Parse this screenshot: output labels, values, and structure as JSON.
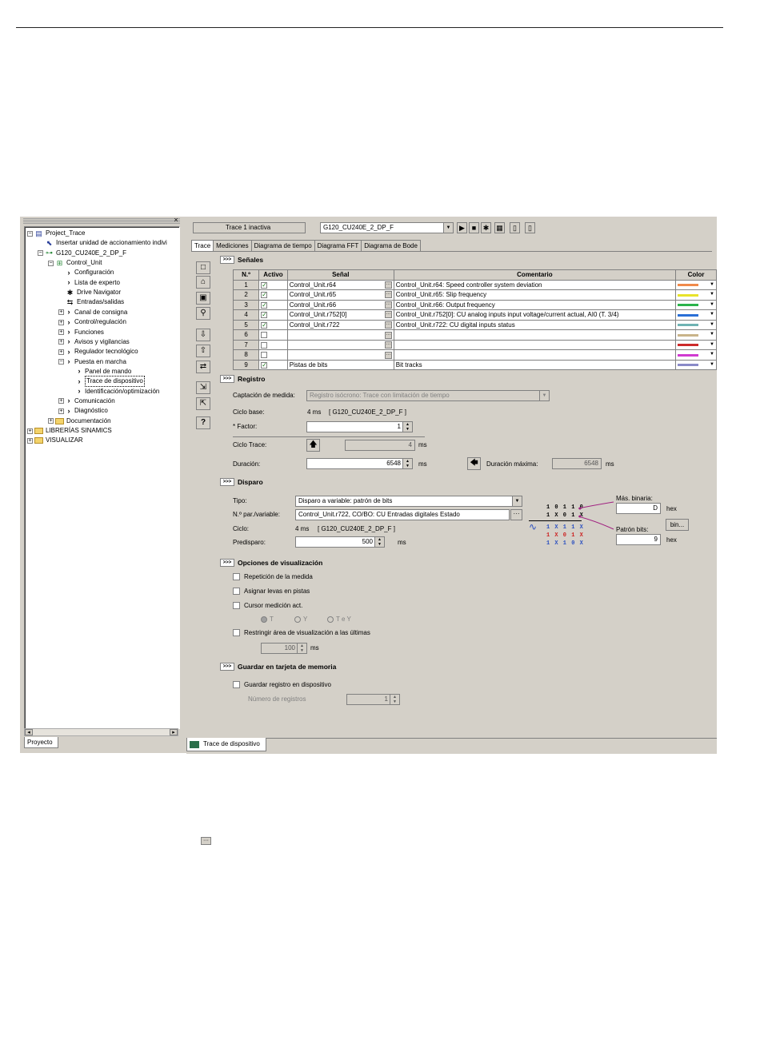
{
  "project": {
    "close_glyph": "×",
    "tab_label": "Proyecto",
    "tree": [
      {
        "label": "Project_Trace",
        "indent": 0,
        "expander": "−",
        "icon": "project"
      },
      {
        "label": "Insertar unidad de accionamiento indivi",
        "indent": 1,
        "expander": "",
        "icon": "insert"
      },
      {
        "label": "G120_CU240E_2_DP_F",
        "indent": 1,
        "expander": "−",
        "icon": "drive"
      },
      {
        "label": "Control_Unit",
        "indent": 2,
        "expander": "−",
        "icon": "unit"
      },
      {
        "label": "Configuración",
        "indent": 3,
        "expander": "",
        "icon": "chevron"
      },
      {
        "label": "Lista de experto",
        "indent": 3,
        "expander": "",
        "icon": "chevron"
      },
      {
        "label": "Drive Navigator",
        "indent": 3,
        "expander": "",
        "icon": "navigator"
      },
      {
        "label": "Entradas/salidas",
        "indent": 3,
        "expander": "",
        "icon": "io"
      },
      {
        "label": "Canal de consigna",
        "indent": 3,
        "expander": "+",
        "icon": "chevron"
      },
      {
        "label": "Control/regulación",
        "indent": 3,
        "expander": "+",
        "icon": "chevron"
      },
      {
        "label": "Funciones",
        "indent": 3,
        "expander": "+",
        "icon": "chevron"
      },
      {
        "label": "Avisos y vigilancias",
        "indent": 3,
        "expander": "+",
        "icon": "chevron"
      },
      {
        "label": "Regulador tecnológico",
        "indent": 3,
        "expander": "+",
        "icon": "chevron"
      },
      {
        "label": "Puesta en marcha",
        "indent": 3,
        "expander": "−",
        "icon": "chevron"
      },
      {
        "label": "Panel de mando",
        "indent": 4,
        "expander": "",
        "icon": "chevron"
      },
      {
        "label": "Trace de dispositivo",
        "indent": 4,
        "expander": "",
        "icon": "chevron",
        "selected": true
      },
      {
        "label": "Identificación/optimización",
        "indent": 4,
        "expander": "",
        "icon": "chevron"
      },
      {
        "label": "Comunicación",
        "indent": 3,
        "expander": "+",
        "icon": "chevron"
      },
      {
        "label": "Diagnóstico",
        "indent": 3,
        "expander": "+",
        "icon": "chevron"
      },
      {
        "label": "Documentación",
        "indent": 2,
        "expander": "+",
        "icon": "folder"
      },
      {
        "label": "LIBRERÍAS SINAMICS",
        "indent": 0,
        "expander": "+",
        "icon": "folder"
      },
      {
        "label": "VISUALIZAR",
        "indent": 0,
        "expander": "+",
        "icon": "folder"
      }
    ]
  },
  "toolbar": {
    "trace_status": "Trace 1 inactiva",
    "device": "G120_CU240E_2_DP_F",
    "buttons": [
      {
        "name": "play-icon",
        "glyph": "▶"
      },
      {
        "name": "stop-icon",
        "glyph": "■"
      },
      {
        "name": "trigger-icon",
        "glyph": "✱"
      },
      {
        "name": "grid-icon",
        "glyph": "▦"
      },
      {
        "name": "panel-a-icon",
        "glyph": "▯"
      },
      {
        "name": "panel-b-icon",
        "glyph": "▯"
      }
    ]
  },
  "tabs": [
    "Trace",
    "Mediciones",
    "Diagrama de tiempo",
    "Diagrama FFT",
    "Diagrama de Bode"
  ],
  "left_tools": [
    {
      "name": "new-icon",
      "glyph": "□"
    },
    {
      "name": "open-icon",
      "glyph": "⌂"
    },
    {
      "name": "save-icon",
      "glyph": "▣"
    },
    {
      "name": "binoculars-icon",
      "glyph": "⚲"
    },
    {
      "name": "load-device-icon",
      "glyph": "⇩"
    },
    {
      "name": "upload-icon",
      "glyph": "⇧"
    },
    {
      "name": "download-icon",
      "glyph": "⇄"
    },
    {
      "name": "export-icon",
      "glyph": "⇲"
    },
    {
      "name": "import-icon",
      "glyph": "⇱"
    },
    {
      "name": "help-icon",
      "glyph": "?"
    }
  ],
  "signals": {
    "expand_glyph": ">>>",
    "title": "Señales",
    "headers": [
      "N.º",
      "Activo",
      "Señal",
      "Comentario",
      "Color"
    ],
    "rows": [
      {
        "n": "1",
        "active": true,
        "signal": "Control_Unit.r64",
        "comment": "Control_Unit.r64: Speed controller system deviation",
        "color": "#f08a4b"
      },
      {
        "n": "2",
        "active": true,
        "signal": "Control_Unit.r65",
        "comment": "Control_Unit.r65: Slip frequency",
        "color": "#e8e32a"
      },
      {
        "n": "3",
        "active": true,
        "signal": "Control_Unit.r66",
        "comment": "Control_Unit.r66: Output frequency",
        "color": "#2bb34a"
      },
      {
        "n": "4",
        "active": true,
        "signal": "Control_Unit.r752[0]",
        "comment": "Control_Unit.r752[0]: CU analog inputs input voltage/current actual, AI0 (T. 3/4)",
        "color": "#2a6fd6"
      },
      {
        "n": "5",
        "active": true,
        "signal": "Control_Unit.r722",
        "comment": "Control_Unit.r722: CU digital inputs status",
        "color": "#6fb3b3"
      },
      {
        "n": "6",
        "active": false,
        "signal": "",
        "comment": "",
        "color": "#c9b48a"
      },
      {
        "n": "7",
        "active": false,
        "signal": "",
        "comment": "",
        "color": "#cc2a2a"
      },
      {
        "n": "8",
        "active": false,
        "signal": "",
        "comment": "",
        "color": "#d03ad0"
      },
      {
        "n": "9",
        "active": true,
        "signal": "Pistas de bits",
        "comment": "Bit tracks",
        "color": "#8a8ac8",
        "nodots": true
      }
    ],
    "dots_glyph": "···",
    "check_glyph": "✓",
    "arrow_glyph": "▼"
  },
  "registro": {
    "title": "Registro",
    "captacion_label": "Captación de medida:",
    "captacion_value": "Registro isócrono: Trace con limitación de tiempo",
    "ciclo_base_label": "Ciclo base:",
    "ciclo_base_value": "4 ms",
    "ciclo_base_device": "[ G120_CU240E_2_DP_F ]",
    "factor_label": "* Factor:",
    "factor_value": "1",
    "ciclo_trace_label": "Ciclo Trace:",
    "ciclo_trace_value": "4",
    "ms": "ms",
    "duracion_label": "Duración:",
    "duracion_value": "6548",
    "duracion_max_label": "Duración máxima:",
    "duracion_max_value": "6548"
  },
  "disparo": {
    "title": "Disparo",
    "tipo_label": "Tipo:",
    "tipo_value": "Disparo a variable: patrón de bits",
    "npar_label": "N.º par./variable:",
    "npar_value": "Control_Unit.r722, CO/BO: CU Entradas digitales Estado",
    "ciclo_label": "Ciclo:",
    "ciclo_value": "4 ms",
    "ciclo_device": "[ G120_CU240E_2_DP_F ]",
    "predisparo_label": "Predisparo:",
    "predisparo_value": "500",
    "ms": "ms",
    "mascara_label": "Más. binaria:",
    "mascara_value": "D",
    "hex": "hex",
    "bin_button": "bin...",
    "patron_label": "Patrón bits:",
    "patron_value": "9",
    "bit_rows": [
      {
        "text": "1 0 1 1 0",
        "color": "#000000"
      },
      {
        "text": "1 X 0 1 X",
        "color": "#000000"
      },
      {
        "text": "1 X 1 1 X",
        "color": "#2a4fc0"
      },
      {
        "text": "1 X 0 1 X",
        "color": "#cc2020"
      },
      {
        "text": "1 X 1 0 X",
        "color": "#2a4fc0"
      }
    ]
  },
  "visualizacion": {
    "title": "Opciones de visualización",
    "options": [
      "Repetición de la medida",
      "Asignar levas en pistas",
      "Cursor medición act."
    ],
    "radios": [
      "T",
      "Y",
      "T e Y"
    ],
    "restringir": "Restringir área de visualización a las últimas",
    "restringir_value": "100",
    "ms": "ms"
  },
  "guardar": {
    "title": "Guardar en tarjeta de memoria",
    "option": "Guardar registro en dispositivo",
    "numero_label": "Número de registros",
    "numero_value": "1"
  },
  "status_tab": "Trace de dispositivo",
  "note_icon_glyph": "···"
}
